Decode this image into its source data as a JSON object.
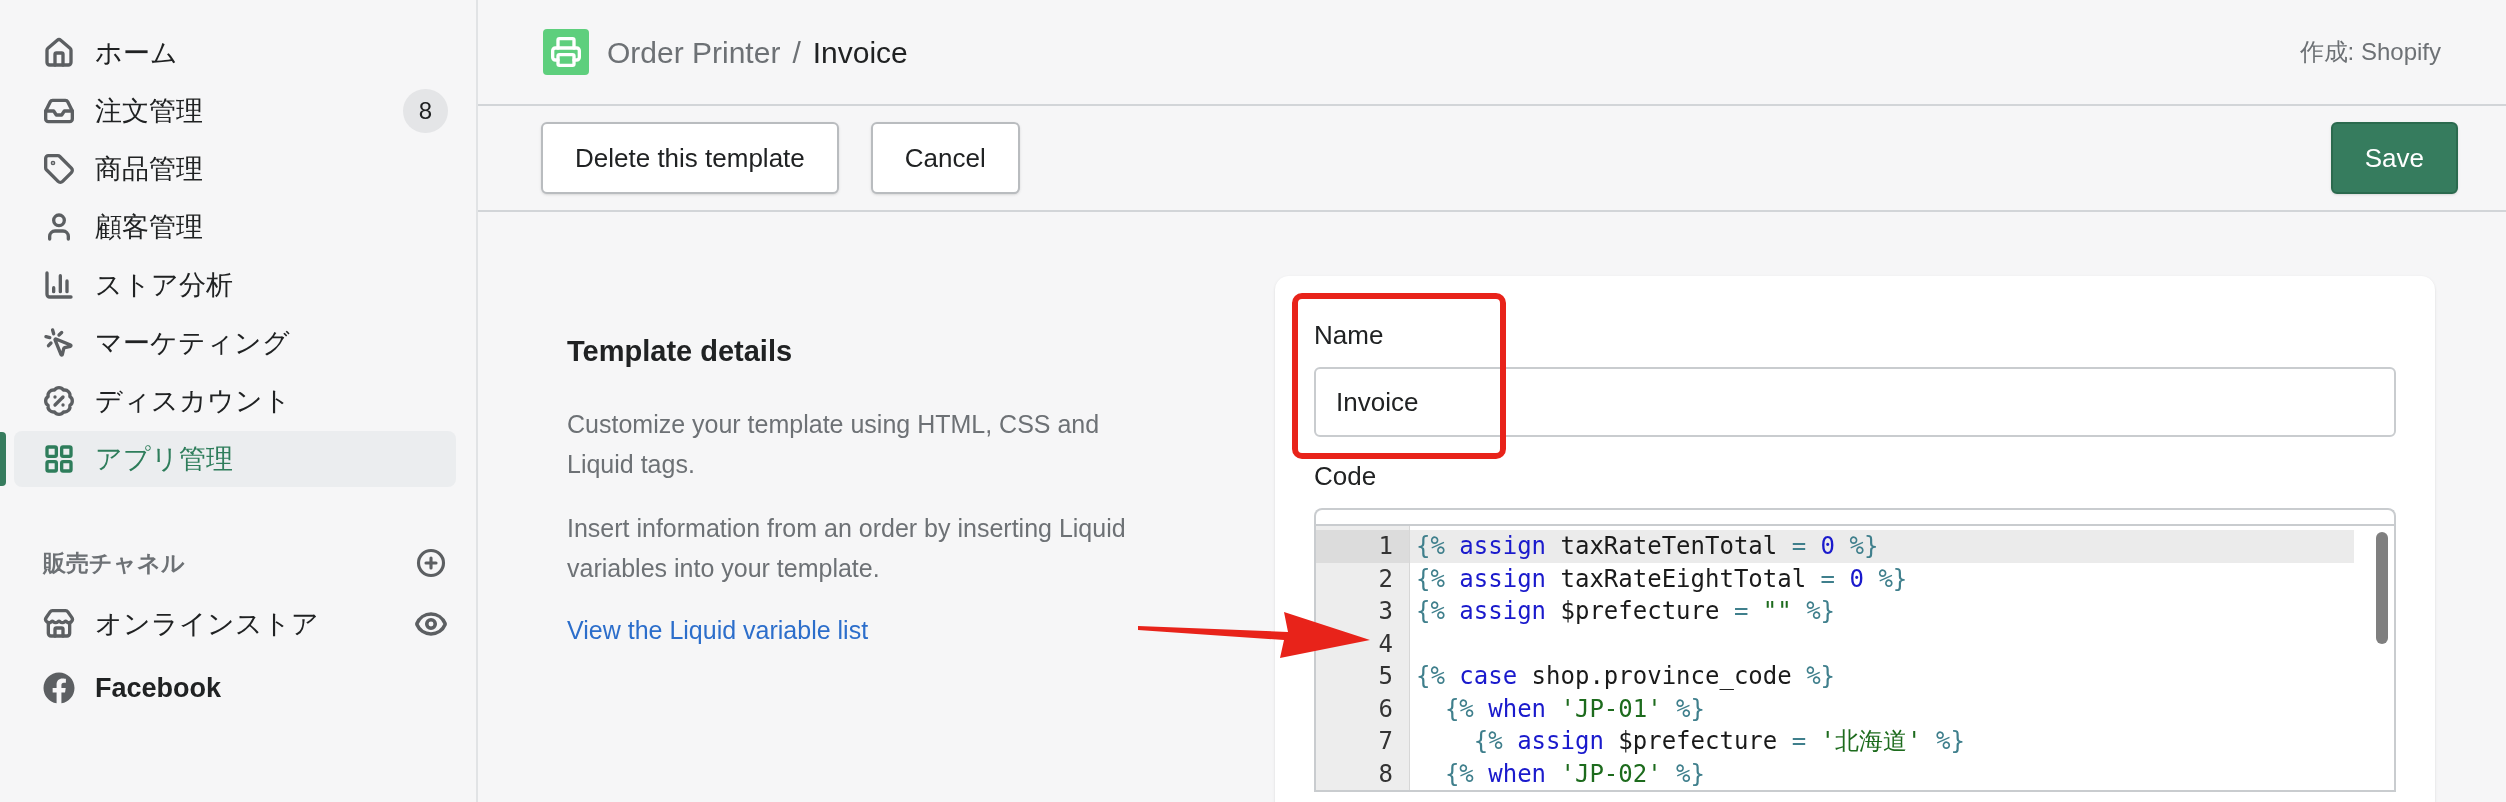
{
  "sidebar": {
    "items": [
      {
        "label": "ホーム",
        "selected": false
      },
      {
        "label": "注文管理",
        "selected": false,
        "badge": "8"
      },
      {
        "label": "商品管理",
        "selected": false
      },
      {
        "label": "顧客管理",
        "selected": false
      },
      {
        "label": "ストア分析",
        "selected": false
      },
      {
        "label": "マーケティング",
        "selected": false
      },
      {
        "label": "ディスカウント",
        "selected": false
      },
      {
        "label": "アプリ管理",
        "selected": true
      }
    ],
    "section_title": "販売チャネル",
    "channels": [
      {
        "label": "オンラインストア"
      },
      {
        "label": "Facebook"
      }
    ]
  },
  "header": {
    "app_name": "Order Printer",
    "separator": "/",
    "page_title": "Invoice",
    "credit": "作成: Shopify"
  },
  "toolbar": {
    "buttons": [
      {
        "label": "Delete this template",
        "kind": "secondary"
      },
      {
        "label": "Cancel",
        "kind": "secondary"
      },
      {
        "label": "Save",
        "kind": "primary"
      }
    ]
  },
  "details": {
    "title": "Template details",
    "paragraphs": [
      "Customize your template using HTML, CSS and Liquid tags.",
      "Insert information from an order by inserting Liquid variables into your template."
    ],
    "link": "View the Liquid variable list"
  },
  "form": {
    "name_label": "Name",
    "name_value": "Invoice",
    "code_label": "Code",
    "code_lines": [
      {
        "number": "1",
        "current": true,
        "tokens": [
          {
            "kind": "delim",
            "text": "{%"
          },
          {
            "kind": "keyword",
            "text": " assign"
          },
          {
            "kind": "plain",
            "text": " taxRateTenTotal"
          },
          {
            "kind": "delim",
            "text": " ="
          },
          {
            "kind": "number",
            "text": " 0"
          },
          {
            "kind": "delim",
            "text": " %}"
          }
        ]
      },
      {
        "number": "2",
        "current": false,
        "tokens": [
          {
            "kind": "delim",
            "text": "{%"
          },
          {
            "kind": "keyword",
            "text": " assign"
          },
          {
            "kind": "plain",
            "text": " taxRateEightTotal"
          },
          {
            "kind": "delim",
            "text": " ="
          },
          {
            "kind": "number",
            "text": " 0"
          },
          {
            "kind": "delim",
            "text": " %}"
          }
        ]
      },
      {
        "number": "3",
        "current": false,
        "tokens": [
          {
            "kind": "delim",
            "text": "{%"
          },
          {
            "kind": "keyword",
            "text": " assign"
          },
          {
            "kind": "plain",
            "text": " $prefecture"
          },
          {
            "kind": "delim",
            "text": " ="
          },
          {
            "kind": "string",
            "text": " \"\""
          },
          {
            "kind": "delim",
            "text": " %}"
          }
        ]
      },
      {
        "number": "4",
        "current": false
      },
      {
        "number": "5",
        "current": false,
        "tokens": [
          {
            "kind": "delim",
            "text": "{%"
          },
          {
            "kind": "keyword",
            "text": " case"
          },
          {
            "kind": "plain",
            "text": " shop.province_code"
          },
          {
            "kind": "delim",
            "text": " %}"
          }
        ]
      },
      {
        "number": "6",
        "current": false,
        "tokens": [
          {
            "kind": "delim",
            "text": "  {%"
          },
          {
            "kind": "keyword",
            "text": " when"
          },
          {
            "kind": "string",
            "text": " 'JP-01'"
          },
          {
            "kind": "delim",
            "text": " %}"
          }
        ]
      },
      {
        "number": "7",
        "current": false,
        "tokens": [
          {
            "kind": "delim",
            "text": "    {%"
          },
          {
            "kind": "keyword",
            "text": " assign"
          },
          {
            "kind": "plain",
            "text": " $prefecture"
          },
          {
            "kind": "delim",
            "text": " ="
          },
          {
            "kind": "string",
            "text": " '北海道'"
          },
          {
            "kind": "delim",
            "text": " %}"
          }
        ]
      },
      {
        "number": "8",
        "current": false,
        "tokens": [
          {
            "kind": "delim",
            "text": "  {%"
          },
          {
            "kind": "keyword",
            "text": " when"
          },
          {
            "kind": "string",
            "text": " 'JP-02'"
          },
          {
            "kind": "delim",
            "text": " %}"
          }
        ]
      }
    ]
  }
}
